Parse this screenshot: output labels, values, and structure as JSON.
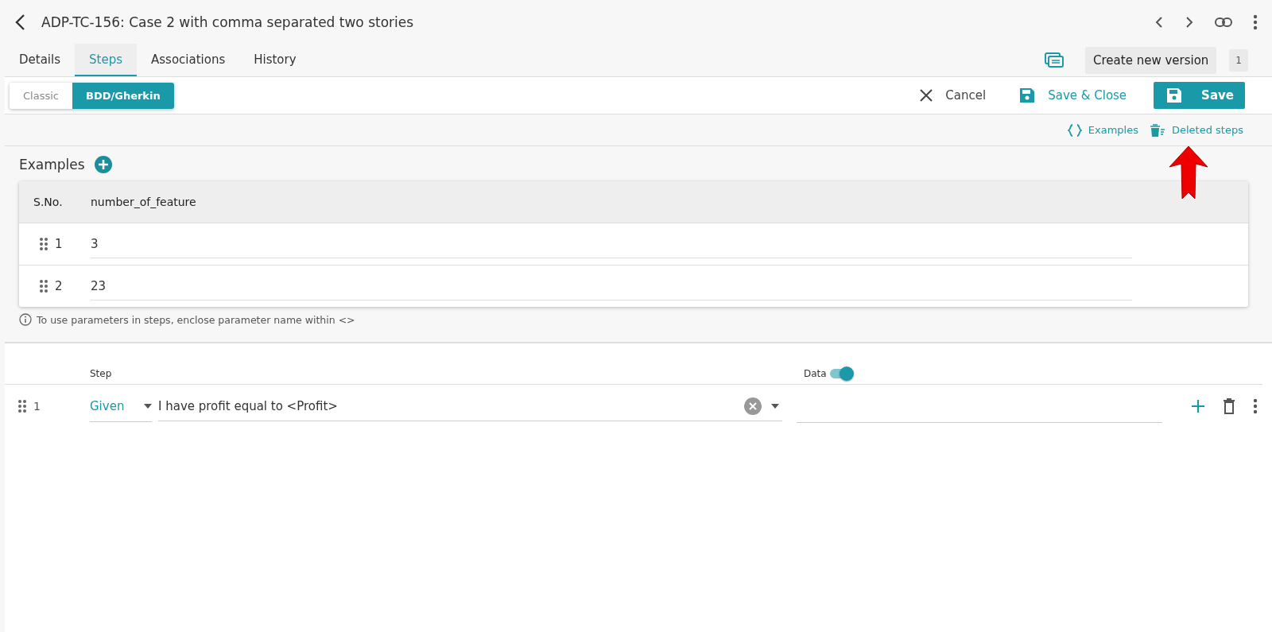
{
  "header": {
    "title": "ADP-TC-156: Case 2 with comma separated two stories"
  },
  "tabs": [
    {
      "label": "Details",
      "selected": false
    },
    {
      "label": "Steps",
      "selected": true
    },
    {
      "label": "Associations",
      "selected": false
    },
    {
      "label": "History",
      "selected": false
    }
  ],
  "version": {
    "button": "Create new version",
    "number": "1"
  },
  "mode_toggle": [
    {
      "label": "Classic",
      "selected": false
    },
    {
      "label": "BDD/Gherkin",
      "selected": true
    }
  ],
  "actions": {
    "cancel": "Cancel",
    "save_close": "Save & Close",
    "save": "Save"
  },
  "links": {
    "examples": "Examples",
    "deleted_steps": "Deleted steps"
  },
  "examples": {
    "title": "Examples",
    "columns": [
      "S.No.",
      "number_of_feature"
    ],
    "rows": [
      {
        "sno": "1",
        "value": "3"
      },
      {
        "sno": "2",
        "value": "23"
      }
    ],
    "hint": "To use parameters in steps, enclose parameter name within <>"
  },
  "steps": {
    "step_header": "Step",
    "data_header": "Data",
    "data_on": true,
    "rows": [
      {
        "number": "1",
        "keyword": "Given",
        "text": "I have profit equal to <Profit>"
      }
    ]
  }
}
